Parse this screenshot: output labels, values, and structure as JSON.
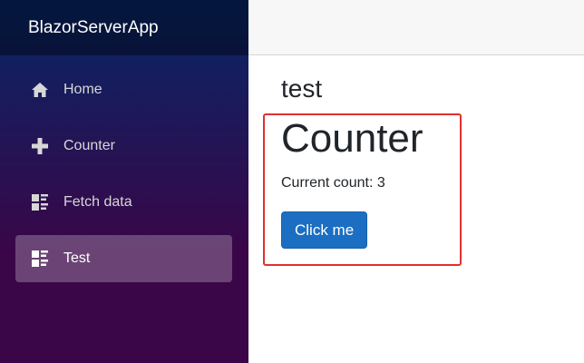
{
  "app": {
    "brand": "BlazorServerApp"
  },
  "sidebar": {
    "items": [
      {
        "label": "Home",
        "icon": "home-icon",
        "active": false
      },
      {
        "label": "Counter",
        "icon": "plus-icon",
        "active": false
      },
      {
        "label": "Fetch data",
        "icon": "list-rich-icon",
        "active": false
      },
      {
        "label": "Test",
        "icon": "list-rich-icon",
        "active": true
      }
    ]
  },
  "main": {
    "page_heading": "test",
    "counter": {
      "title": "Counter",
      "count_label": "Current count: 3",
      "button_label": "Click me"
    }
  },
  "colors": {
    "button_primary": "#1b6ec2",
    "highlight_border": "#e03030",
    "sidebar_gradient_top": "#052767",
    "sidebar_gradient_bottom": "#3a0647"
  }
}
